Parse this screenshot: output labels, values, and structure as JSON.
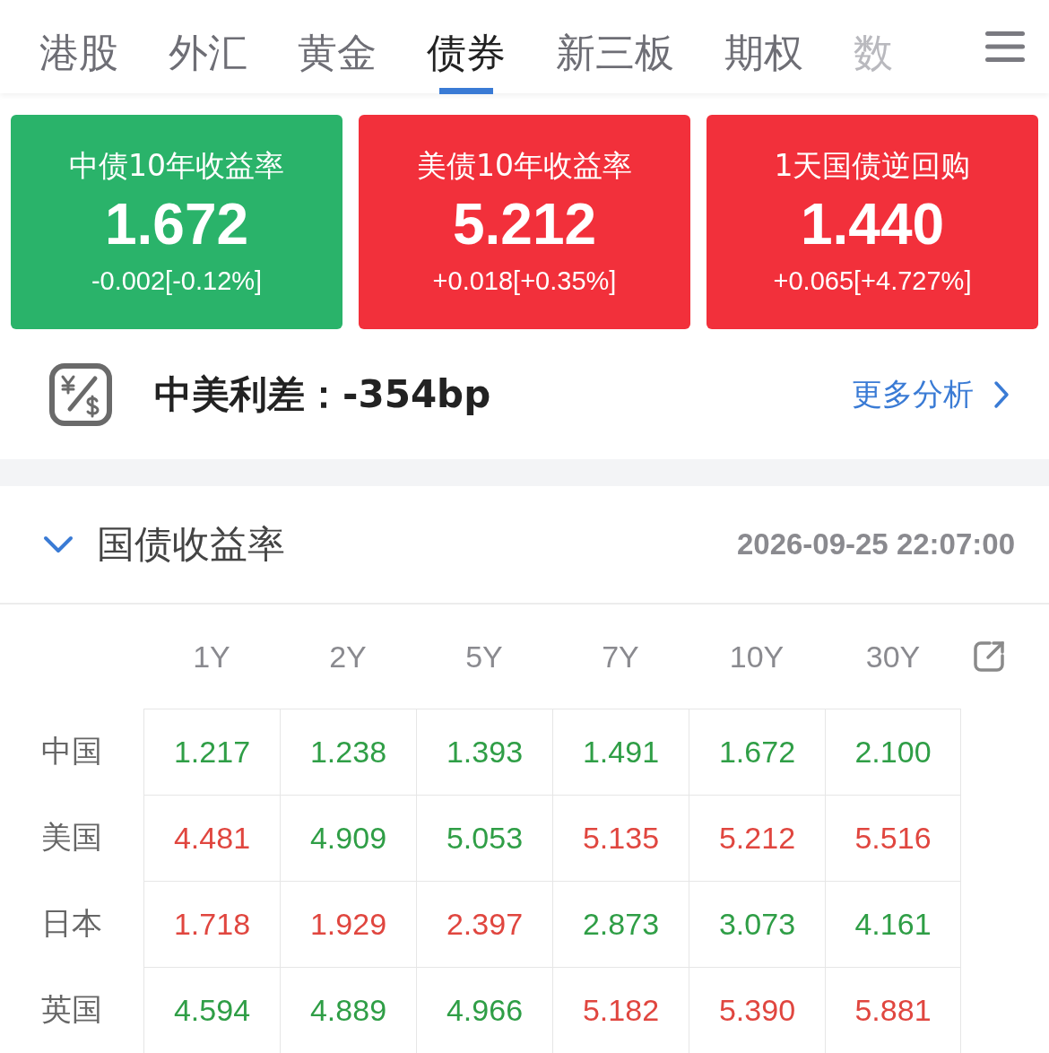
{
  "tabs": [
    {
      "label": "港股",
      "selected": false
    },
    {
      "label": "外汇",
      "selected": false
    },
    {
      "label": "黄金",
      "selected": false
    },
    {
      "label": "债券",
      "selected": true
    },
    {
      "label": "新三板",
      "selected": false
    },
    {
      "label": "期权",
      "selected": false
    },
    {
      "label": "数",
      "selected": false
    }
  ],
  "cards": [
    {
      "title": "中债10年收益率",
      "value": "1.672",
      "change": "-0.002[-0.12%]",
      "color": "#2ab36a"
    },
    {
      "title": "美债10年收益率",
      "value": "5.212",
      "change": "+0.018[+0.35%]",
      "color": "#f2303b"
    },
    {
      "title": "1天国债逆回购",
      "value": "1.440",
      "change": "+0.065[+4.727%]",
      "color": "#f2303b"
    }
  ],
  "spread": {
    "label": "中美利差：-354bp",
    "link": "更多分析"
  },
  "section": {
    "title": "国债收益率",
    "expanded": true,
    "timestamp": "2026-09-25 22:07:00"
  },
  "table": {
    "columns": [
      "1Y",
      "2Y",
      "5Y",
      "7Y",
      "10Y",
      "30Y"
    ],
    "rows": [
      {
        "country": "中国",
        "cells": [
          {
            "value": "1.217",
            "color": "#2f9e46"
          },
          {
            "value": "1.238",
            "color": "#2f9e46"
          },
          {
            "value": "1.393",
            "color": "#2f9e46"
          },
          {
            "value": "1.491",
            "color": "#2f9e46"
          },
          {
            "value": "1.672",
            "color": "#2f9e46"
          },
          {
            "value": "2.100",
            "color": "#2f9e46"
          }
        ]
      },
      {
        "country": "美国",
        "cells": [
          {
            "value": "4.481",
            "color": "#e0463f"
          },
          {
            "value": "4.909",
            "color": "#2f9e46"
          },
          {
            "value": "5.053",
            "color": "#2f9e46"
          },
          {
            "value": "5.135",
            "color": "#e0463f"
          },
          {
            "value": "5.212",
            "color": "#e0463f"
          },
          {
            "value": "5.516",
            "color": "#e0463f"
          }
        ]
      },
      {
        "country": "日本",
        "cells": [
          {
            "value": "1.718",
            "color": "#e0463f"
          },
          {
            "value": "1.929",
            "color": "#e0463f"
          },
          {
            "value": "2.397",
            "color": "#e0463f"
          },
          {
            "value": "2.873",
            "color": "#2f9e46"
          },
          {
            "value": "3.073",
            "color": "#2f9e46"
          },
          {
            "value": "4.161",
            "color": "#2f9e46"
          }
        ]
      },
      {
        "country": "英国",
        "cells": [
          {
            "value": "4.594",
            "color": "#2f9e46"
          },
          {
            "value": "4.889",
            "color": "#2f9e46"
          },
          {
            "value": "4.966",
            "color": "#2f9e46"
          },
          {
            "value": "5.182",
            "color": "#e0463f"
          },
          {
            "value": "5.390",
            "color": "#e0463f"
          },
          {
            "value": "5.881",
            "color": "#e0463f"
          }
        ]
      }
    ]
  }
}
